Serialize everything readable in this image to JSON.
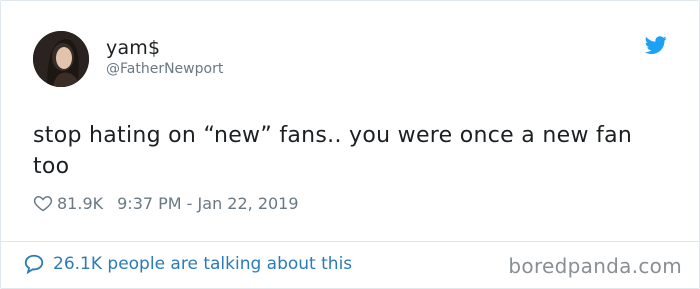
{
  "tweet": {
    "author": {
      "name": "yam$",
      "handle": "@FatherNewport"
    },
    "text": "stop hating on “new” fans.. you were once a new fan too",
    "likes": "81.9K",
    "timestamp": "9:37 PM - Jan 22, 2019"
  },
  "footer": {
    "conversation_label": "26.1K people are talking about this"
  },
  "watermark": "boredpanda.com",
  "icons": {
    "brand": "twitter-bird-icon",
    "like": "heart-icon",
    "conversation": "speech-bubble-icon"
  },
  "colors": {
    "twitter_blue": "#1da1f2",
    "link_blue": "#2b7bb9",
    "text": "#1c2022",
    "muted": "#697882",
    "border": "#e1e8ed"
  }
}
